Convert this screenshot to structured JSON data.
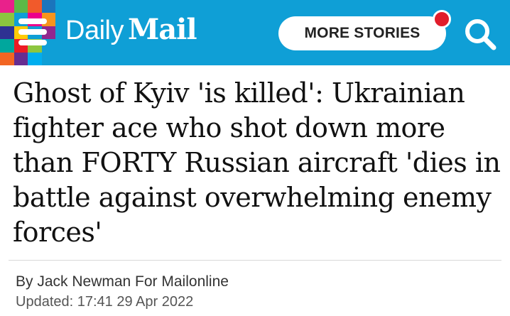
{
  "header": {
    "logo_daily": "Daily",
    "logo_mail": "Mail",
    "more_stories_label": "MORE STORIES",
    "bg_color": "#0f9fd6",
    "notification_color": "#e11d2b",
    "mosaic_colors": [
      "#e9218b",
      "#5bb947",
      "#f15a2b",
      "#1b75bc",
      "#8bc53f",
      "#0f9fd6",
      "#ec008c",
      "#f7941d",
      "#2e3192",
      "#ffcb05",
      "#0f9fd6",
      "#92278f",
      "#00a79d",
      "#ed1c24",
      "#8dc63f",
      "#0f9fd6",
      "#f26522",
      "#662d91",
      "#00aeef",
      "#0f9fd6"
    ],
    "icons": [
      "menu-icon",
      "search-icon"
    ]
  },
  "article": {
    "headline": "Ghost of Kyiv 'is killed': Ukrainian fighter ace who shot down more than FORTY Russian aircraft 'dies in battle against overwhelming enemy forces'",
    "byline": "By Jack Newman For Mailonline",
    "updated": "Updated: 17:41 29 Apr 2022"
  }
}
